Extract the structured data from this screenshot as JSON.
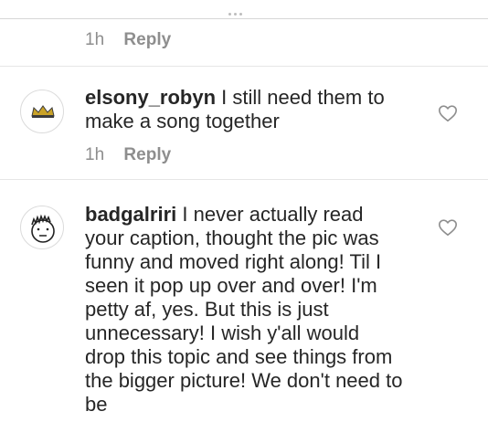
{
  "top_comment": {
    "time": "1h",
    "reply_label": "Reply"
  },
  "comments": [
    {
      "username": "elsony_robyn",
      "text": "I still need them to make a song together",
      "time": "1h",
      "reply_label": "Reply",
      "avatar_icon": "crown-icon",
      "like_icon": "heart-outline-icon"
    },
    {
      "username": "badgalriri",
      "text": "I never actually read your caption, thought the pic was funny and moved right along! Til I seen it pop up over and over! I'm petty af, yes. But this is just unnecessary! I wish y'all would drop this topic and see things from the bigger picture! We don't need to be",
      "avatar_icon": "cartoon-face-icon",
      "like_icon": "heart-outline-icon"
    }
  ],
  "colors": {
    "text": "#262626",
    "muted": "#8e8e8e",
    "divider": "#e6e6e6",
    "crown": "#c9a227"
  }
}
